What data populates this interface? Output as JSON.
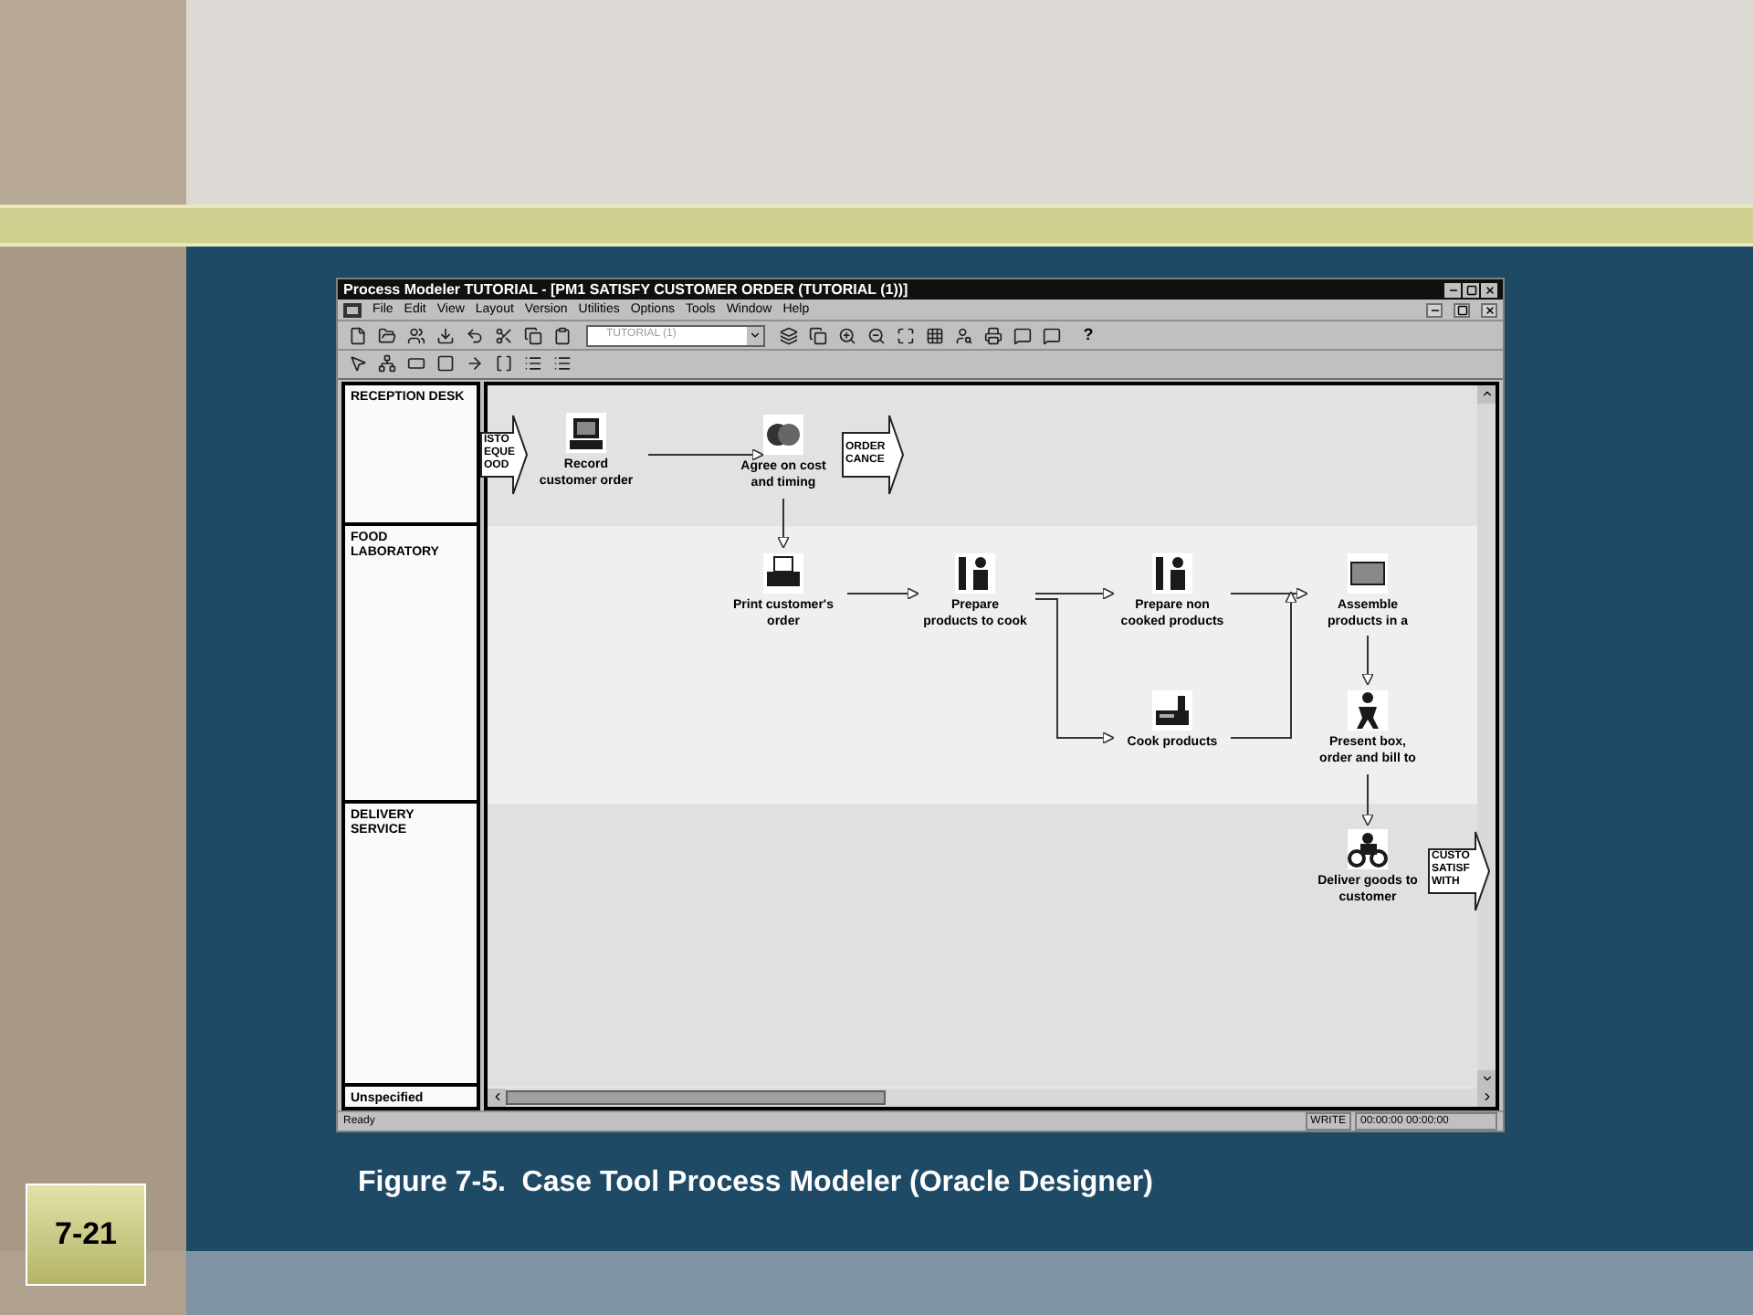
{
  "window": {
    "title": "Process Modeler TUTORIAL - [PM1 SATISFY CUSTOMER ORDER (TUTORIAL (1))]",
    "menu": [
      "File",
      "Edit",
      "View",
      "Layout",
      "Version",
      "Utilities",
      "Options",
      "Tools",
      "Window",
      "Help"
    ],
    "dropdown": {
      "value": "TUTORIAL (1)"
    },
    "help_button": "?"
  },
  "lanes": [
    {
      "label": "RECEPTION DESK"
    },
    {
      "label": "FOOD\nLABORATORY"
    },
    {
      "label": "DELIVERY\nSERVICE"
    },
    {
      "label": "Unspecified"
    }
  ],
  "processes": [
    {
      "label": "Record\ncustomer order"
    },
    {
      "label": "Agree on cost\nand timing"
    },
    {
      "label": "Print customer's\norder"
    },
    {
      "label": "Prepare\nproducts to cook"
    },
    {
      "label": "Prepare non\ncooked products"
    },
    {
      "label": "Assemble\nproducts in a"
    },
    {
      "label": "Cook products"
    },
    {
      "label": "Present box,\norder and bill to"
    },
    {
      "label": "Deliver goods to\ncustomer"
    }
  ],
  "flows": [
    {
      "label": "ISTO\nEQUE\nOOD"
    },
    {
      "label": "ORDER\nCANCE"
    },
    {
      "label": "CUSTO\nSATISF\nWITH"
    }
  ],
  "status_bar": {
    "message": "Ready",
    "mode": "WRITE",
    "time": "00:00:00 00:00:00"
  },
  "caption": "Figure 7-5.  Case Tool Process Modeler (Oracle Designer)",
  "slide_number": "7-21"
}
